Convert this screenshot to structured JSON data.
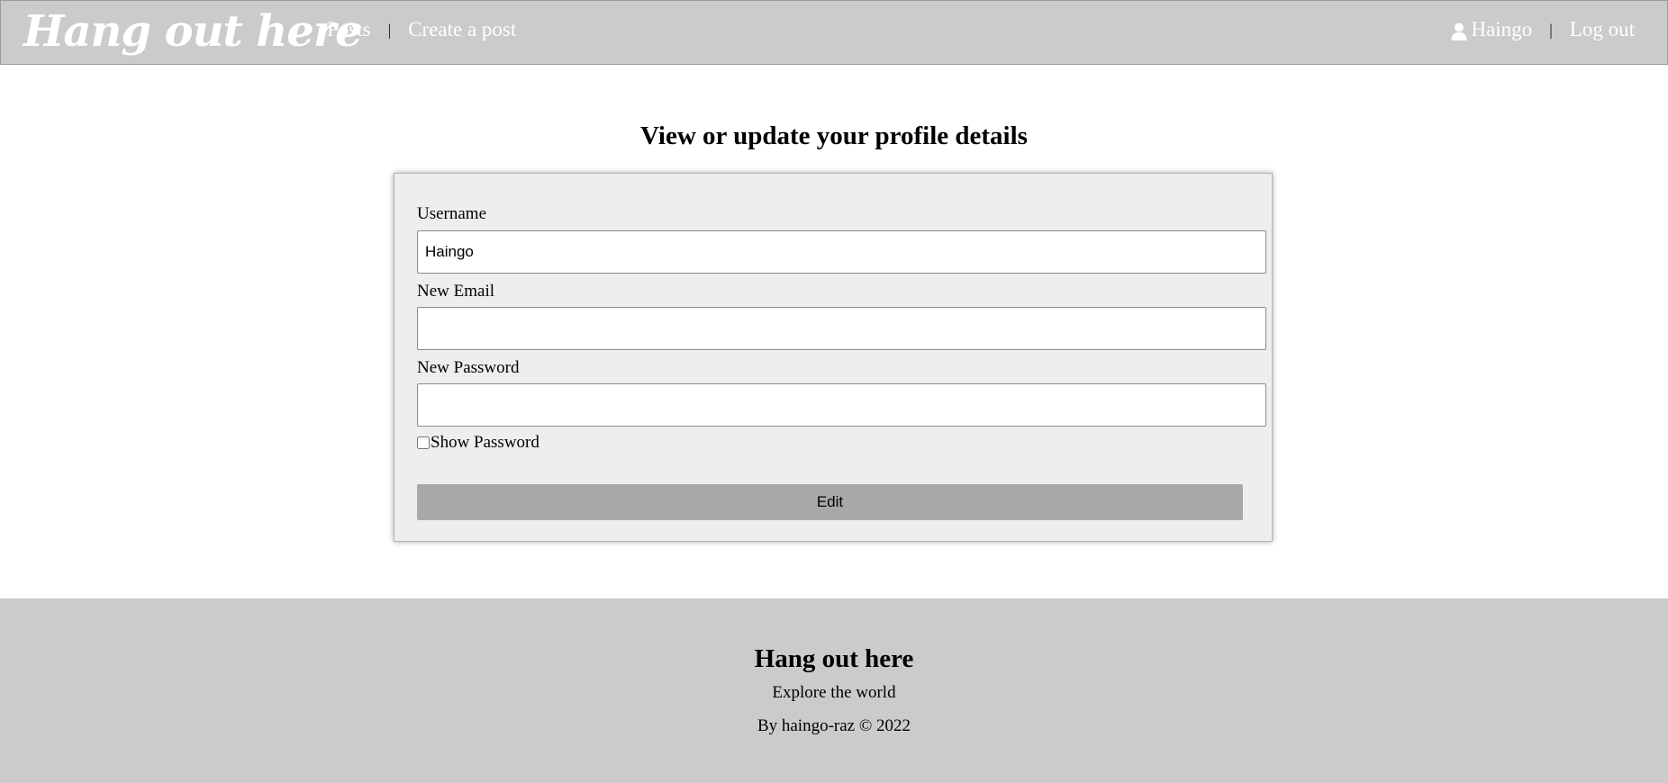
{
  "header": {
    "logo": "Hang out here",
    "nav": {
      "posts": "Posts",
      "separator": "|",
      "create_post": "Create a post"
    },
    "user": {
      "icon": "user-icon",
      "name": "Haingo",
      "separator": "|",
      "logout": "Log out"
    }
  },
  "main": {
    "title": "View or update your profile details",
    "form": {
      "username_label": "Username",
      "username_value": "Haingo",
      "email_label": "New Email",
      "email_value": "",
      "password_label": "New Password",
      "password_value": "",
      "show_password_label": "Show Password",
      "show_password_checked": false,
      "submit_label": "Edit"
    }
  },
  "footer": {
    "title": "Hang out here",
    "tagline": "Explore the world",
    "credit": "By haingo-raz © 2022"
  },
  "colors": {
    "header_bg": "#cbcbcb",
    "form_bg": "#eeeeee",
    "button_bg": "#a9a8a9",
    "footer_bg": "#cbcbcb"
  }
}
